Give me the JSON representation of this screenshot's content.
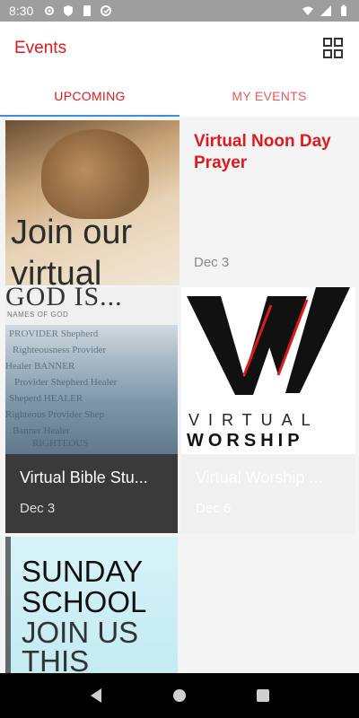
{
  "status_bar": {
    "time": "8:30"
  },
  "app_bar": {
    "title": "Events"
  },
  "tabs": [
    {
      "label": "UPCOMING",
      "active": true
    },
    {
      "label": "MY EVENTS",
      "active": false
    }
  ],
  "events": [
    {
      "title": "Virtual Noon Day Prayer",
      "date": "Dec 3",
      "image_text": [
        "Join our",
        "virtual"
      ]
    },
    {
      "title": "Virtual Bible Stu...",
      "date": "Dec 3",
      "image_text": [
        "GOD IS...",
        "NAMES OF GOD"
      ]
    },
    {
      "title": "Virtual Worship ...",
      "date": "Dec 6",
      "image_text": [
        "VIRTUAL",
        "WORSHIP"
      ]
    },
    {
      "title": "",
      "date": "",
      "image_text": [
        "SUNDAY",
        "SCHOOL",
        "JOIN US",
        "THIS WEEK"
      ]
    }
  ],
  "colors": {
    "accent": "#e0191f",
    "tab_indicator": "#3b8fd6"
  }
}
